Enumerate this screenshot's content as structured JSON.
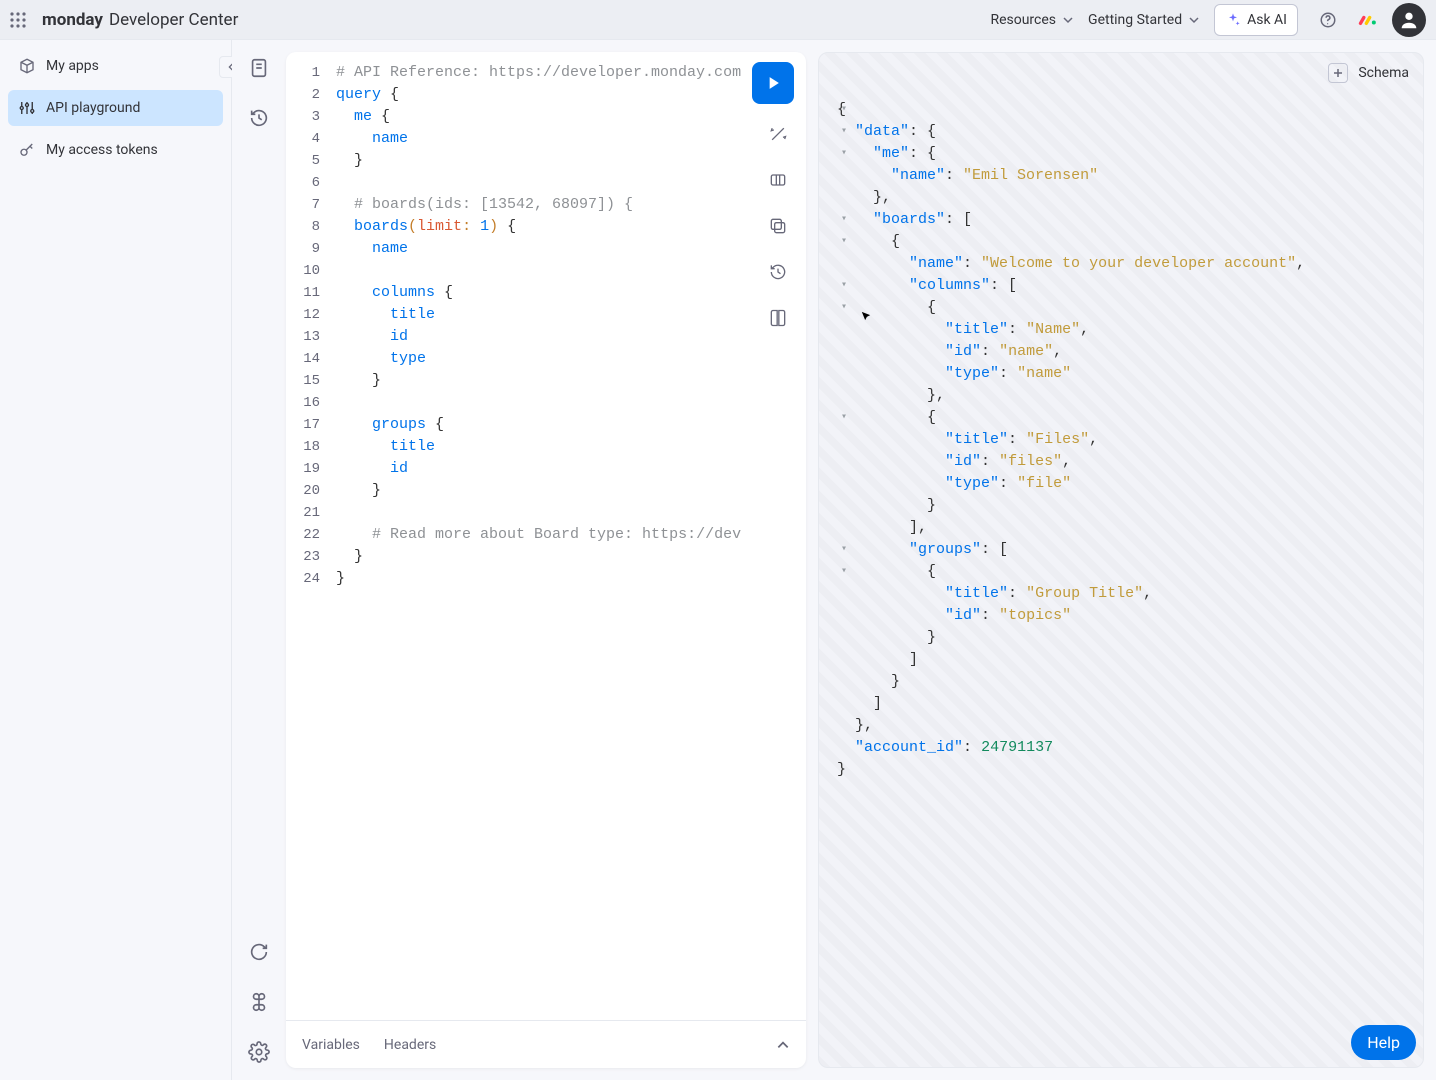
{
  "topbar": {
    "brand_bold": "monday",
    "brand_rest": "Developer Center",
    "resources_label": "Resources",
    "getting_started_label": "Getting Started",
    "ask_ai_label": "Ask AI"
  },
  "sidebar": {
    "items": [
      {
        "id": "my-apps",
        "label": "My apps",
        "icon": "package"
      },
      {
        "id": "api-playground",
        "label": "API playground",
        "icon": "sliders"
      },
      {
        "id": "my-access-tokens",
        "label": "My access tokens",
        "icon": "key"
      }
    ],
    "selected": "api-playground"
  },
  "editor": {
    "footer": {
      "variables_label": "Variables",
      "headers_label": "Headers"
    },
    "lines": [
      {
        "n": 1,
        "fold": "",
        "tokens": [
          {
            "t": "comment",
            "v": "# API Reference: https://developer.monday.com"
          }
        ]
      },
      {
        "n": 2,
        "fold": "▾",
        "tokens": [
          {
            "t": "kw",
            "v": "query"
          },
          {
            "t": "plain",
            "v": " "
          },
          {
            "t": "brace",
            "v": "{"
          }
        ]
      },
      {
        "n": 3,
        "fold": "▾",
        "tokens": [
          {
            "t": "plain",
            "v": "  "
          },
          {
            "t": "field",
            "v": "me"
          },
          {
            "t": "plain",
            "v": " "
          },
          {
            "t": "brace",
            "v": "{"
          }
        ]
      },
      {
        "n": 4,
        "fold": "",
        "tokens": [
          {
            "t": "plain",
            "v": "    "
          },
          {
            "t": "field",
            "v": "name"
          }
        ]
      },
      {
        "n": 5,
        "fold": "",
        "tokens": [
          {
            "t": "plain",
            "v": "  "
          },
          {
            "t": "brace",
            "v": "}"
          }
        ]
      },
      {
        "n": 6,
        "fold": "",
        "tokens": []
      },
      {
        "n": 7,
        "fold": "",
        "tokens": [
          {
            "t": "plain",
            "v": "  "
          },
          {
            "t": "comment",
            "v": "# boards(ids: [13542, 68097]) {"
          }
        ]
      },
      {
        "n": 8,
        "fold": "▾",
        "tokens": [
          {
            "t": "plain",
            "v": "  "
          },
          {
            "t": "field",
            "v": "boards"
          },
          {
            "t": "paren",
            "v": "("
          },
          {
            "t": "arg",
            "v": "limit"
          },
          {
            "t": "paren",
            "v": ":"
          },
          {
            "t": "plain",
            "v": " "
          },
          {
            "t": "num",
            "v": "1"
          },
          {
            "t": "paren",
            "v": ")"
          },
          {
            "t": "plain",
            "v": " "
          },
          {
            "t": "brace",
            "v": "{"
          }
        ]
      },
      {
        "n": 9,
        "fold": "",
        "tokens": [
          {
            "t": "plain",
            "v": "    "
          },
          {
            "t": "field",
            "v": "name"
          }
        ]
      },
      {
        "n": 10,
        "fold": "",
        "tokens": []
      },
      {
        "n": 11,
        "fold": "▾",
        "tokens": [
          {
            "t": "plain",
            "v": "    "
          },
          {
            "t": "field",
            "v": "columns"
          },
          {
            "t": "plain",
            "v": " "
          },
          {
            "t": "brace",
            "v": "{"
          }
        ]
      },
      {
        "n": 12,
        "fold": "",
        "tokens": [
          {
            "t": "plain",
            "v": "      "
          },
          {
            "t": "field",
            "v": "title"
          }
        ]
      },
      {
        "n": 13,
        "fold": "",
        "tokens": [
          {
            "t": "plain",
            "v": "      "
          },
          {
            "t": "field",
            "v": "id"
          }
        ]
      },
      {
        "n": 14,
        "fold": "",
        "tokens": [
          {
            "t": "plain",
            "v": "      "
          },
          {
            "t": "field",
            "v": "type"
          }
        ]
      },
      {
        "n": 15,
        "fold": "",
        "tokens": [
          {
            "t": "plain",
            "v": "    "
          },
          {
            "t": "brace",
            "v": "}"
          }
        ]
      },
      {
        "n": 16,
        "fold": "",
        "tokens": []
      },
      {
        "n": 17,
        "fold": "▾",
        "tokens": [
          {
            "t": "plain",
            "v": "    "
          },
          {
            "t": "field",
            "v": "groups"
          },
          {
            "t": "plain",
            "v": " "
          },
          {
            "t": "brace",
            "v": "{"
          }
        ]
      },
      {
        "n": 18,
        "fold": "",
        "tokens": [
          {
            "t": "plain",
            "v": "      "
          },
          {
            "t": "field",
            "v": "title"
          }
        ]
      },
      {
        "n": 19,
        "fold": "",
        "tokens": [
          {
            "t": "plain",
            "v": "      "
          },
          {
            "t": "field",
            "v": "id"
          }
        ]
      },
      {
        "n": 20,
        "fold": "",
        "tokens": [
          {
            "t": "plain",
            "v": "    "
          },
          {
            "t": "brace",
            "v": "}"
          }
        ]
      },
      {
        "n": 21,
        "fold": "",
        "tokens": []
      },
      {
        "n": 22,
        "fold": "",
        "tokens": [
          {
            "t": "plain",
            "v": "    "
          },
          {
            "t": "comment",
            "v": "# Read more about Board type: https://dev"
          }
        ]
      },
      {
        "n": 23,
        "fold": "",
        "tokens": [
          {
            "t": "plain",
            "v": "  "
          },
          {
            "t": "brace",
            "v": "}"
          }
        ]
      },
      {
        "n": 24,
        "fold": "",
        "tokens": [
          {
            "t": "brace",
            "v": "}"
          }
        ]
      }
    ]
  },
  "result": {
    "schema_label": "Schema",
    "lines": [
      {
        "indent": 0,
        "fold": true,
        "tokens": [
          {
            "t": "rp",
            "v": "{"
          }
        ]
      },
      {
        "indent": 1,
        "fold": true,
        "tokens": [
          {
            "t": "rk",
            "v": "\"data\""
          },
          {
            "t": "rp",
            "v": ": {"
          }
        ]
      },
      {
        "indent": 2,
        "fold": true,
        "tokens": [
          {
            "t": "rk",
            "v": "\"me\""
          },
          {
            "t": "rp",
            "v": ": {"
          }
        ]
      },
      {
        "indent": 3,
        "fold": false,
        "tokens": [
          {
            "t": "rk",
            "v": "\"name\""
          },
          {
            "t": "rp",
            "v": ": "
          },
          {
            "t": "rs",
            "v": "\"Emil Sorensen\""
          }
        ]
      },
      {
        "indent": 2,
        "fold": false,
        "tokens": [
          {
            "t": "rp",
            "v": "},"
          }
        ]
      },
      {
        "indent": 2,
        "fold": true,
        "tokens": [
          {
            "t": "rk",
            "v": "\"boards\""
          },
          {
            "t": "rp",
            "v": ": ["
          }
        ]
      },
      {
        "indent": 3,
        "fold": true,
        "tokens": [
          {
            "t": "rp",
            "v": "{"
          }
        ]
      },
      {
        "indent": 4,
        "fold": false,
        "tokens": [
          {
            "t": "rk",
            "v": "\"name\""
          },
          {
            "t": "rp",
            "v": ": "
          },
          {
            "t": "rs",
            "v": "\"Welcome to your developer account\""
          },
          {
            "t": "rp",
            "v": ","
          }
        ]
      },
      {
        "indent": 4,
        "fold": true,
        "tokens": [
          {
            "t": "rk",
            "v": "\"columns\""
          },
          {
            "t": "rp",
            "v": ": ["
          }
        ]
      },
      {
        "indent": 5,
        "fold": true,
        "tokens": [
          {
            "t": "rp",
            "v": "{"
          }
        ]
      },
      {
        "indent": 6,
        "fold": false,
        "tokens": [
          {
            "t": "rk",
            "v": "\"title\""
          },
          {
            "t": "rp",
            "v": ": "
          },
          {
            "t": "rs",
            "v": "\"Name\""
          },
          {
            "t": "rp",
            "v": ","
          }
        ]
      },
      {
        "indent": 6,
        "fold": false,
        "tokens": [
          {
            "t": "rk",
            "v": "\"id\""
          },
          {
            "t": "rp",
            "v": ": "
          },
          {
            "t": "rs",
            "v": "\"name\""
          },
          {
            "t": "rp",
            "v": ","
          }
        ]
      },
      {
        "indent": 6,
        "fold": false,
        "tokens": [
          {
            "t": "rk",
            "v": "\"type\""
          },
          {
            "t": "rp",
            "v": ": "
          },
          {
            "t": "rs",
            "v": "\"name\""
          }
        ]
      },
      {
        "indent": 5,
        "fold": false,
        "tokens": [
          {
            "t": "rp",
            "v": "},"
          }
        ]
      },
      {
        "indent": 5,
        "fold": true,
        "tokens": [
          {
            "t": "rp",
            "v": "{"
          }
        ]
      },
      {
        "indent": 6,
        "fold": false,
        "tokens": [
          {
            "t": "rk",
            "v": "\"title\""
          },
          {
            "t": "rp",
            "v": ": "
          },
          {
            "t": "rs",
            "v": "\"Files\""
          },
          {
            "t": "rp",
            "v": ","
          }
        ]
      },
      {
        "indent": 6,
        "fold": false,
        "tokens": [
          {
            "t": "rk",
            "v": "\"id\""
          },
          {
            "t": "rp",
            "v": ": "
          },
          {
            "t": "rs",
            "v": "\"files\""
          },
          {
            "t": "rp",
            "v": ","
          }
        ]
      },
      {
        "indent": 6,
        "fold": false,
        "tokens": [
          {
            "t": "rk",
            "v": "\"type\""
          },
          {
            "t": "rp",
            "v": ": "
          },
          {
            "t": "rs",
            "v": "\"file\""
          }
        ]
      },
      {
        "indent": 5,
        "fold": false,
        "tokens": [
          {
            "t": "rp",
            "v": "}"
          }
        ]
      },
      {
        "indent": 4,
        "fold": false,
        "tokens": [
          {
            "t": "rp",
            "v": "],"
          }
        ]
      },
      {
        "indent": 4,
        "fold": true,
        "tokens": [
          {
            "t": "rk",
            "v": "\"groups\""
          },
          {
            "t": "rp",
            "v": ": ["
          }
        ]
      },
      {
        "indent": 5,
        "fold": true,
        "tokens": [
          {
            "t": "rp",
            "v": "{"
          }
        ]
      },
      {
        "indent": 6,
        "fold": false,
        "tokens": [
          {
            "t": "rk",
            "v": "\"title\""
          },
          {
            "t": "rp",
            "v": ": "
          },
          {
            "t": "rs",
            "v": "\"Group Title\""
          },
          {
            "t": "rp",
            "v": ","
          }
        ]
      },
      {
        "indent": 6,
        "fold": false,
        "tokens": [
          {
            "t": "rk",
            "v": "\"id\""
          },
          {
            "t": "rp",
            "v": ": "
          },
          {
            "t": "rs",
            "v": "\"topics\""
          }
        ]
      },
      {
        "indent": 5,
        "fold": false,
        "tokens": [
          {
            "t": "rp",
            "v": "}"
          }
        ]
      },
      {
        "indent": 4,
        "fold": false,
        "tokens": [
          {
            "t": "rp",
            "v": "]"
          }
        ]
      },
      {
        "indent": 3,
        "fold": false,
        "tokens": [
          {
            "t": "rp",
            "v": "}"
          }
        ]
      },
      {
        "indent": 2,
        "fold": false,
        "tokens": [
          {
            "t": "rp",
            "v": "]"
          }
        ]
      },
      {
        "indent": 1,
        "fold": false,
        "tokens": [
          {
            "t": "rp",
            "v": "},"
          }
        ]
      },
      {
        "indent": 1,
        "fold": false,
        "tokens": [
          {
            "t": "rk",
            "v": "\"account_id\""
          },
          {
            "t": "rp",
            "v": ": "
          },
          {
            "t": "rn",
            "v": "24791137"
          }
        ]
      },
      {
        "indent": 0,
        "fold": false,
        "tokens": [
          {
            "t": "rp",
            "v": "}"
          }
        ]
      }
    ]
  },
  "help": {
    "label": "Help"
  }
}
